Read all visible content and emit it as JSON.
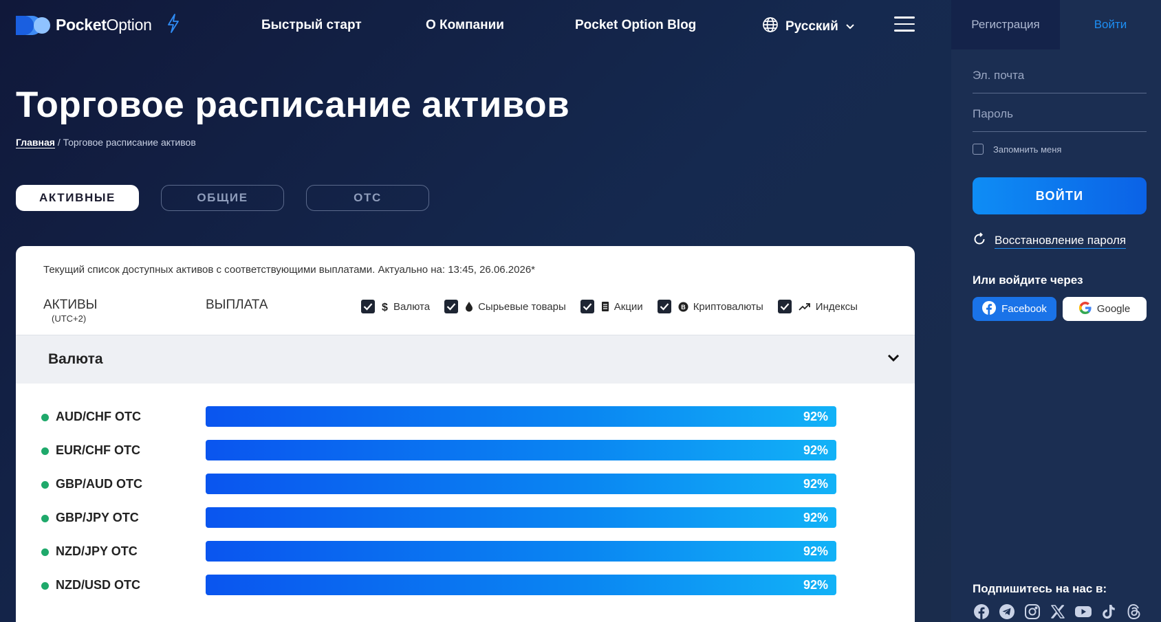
{
  "brand": {
    "name_bold": "Pocket",
    "name_regular": "Option"
  },
  "nav": [
    {
      "label": "Быстрый старт"
    },
    {
      "label": "О Компании"
    },
    {
      "label": "Pocket Option Blog"
    }
  ],
  "language": {
    "label": "Русский"
  },
  "page": {
    "title": "Торговое расписание активов",
    "breadcrumb_home": "Главная",
    "breadcrumb_sep": " / ",
    "breadcrumb_current": "Торговое расписание активов"
  },
  "tabs": [
    {
      "label": "АКТИВНЫЕ",
      "active": true
    },
    {
      "label": "ОБЩИЕ",
      "active": false
    },
    {
      "label": "OTC",
      "active": false
    }
  ],
  "table": {
    "note": "Текущий список доступных активов с соответствующими выплатами. Актуально на: 13:45, 26.06.2026*",
    "col_assets": "АКТИВЫ",
    "col_assets_tz": "(UTC+2)",
    "col_payout": "ВЫПЛАТА",
    "filters": [
      {
        "label": "Валюта",
        "icon": "dollar-icon",
        "checked": true
      },
      {
        "label": "Сырьевые товары",
        "icon": "drop-icon",
        "checked": true
      },
      {
        "label": "Акции",
        "icon": "document-icon",
        "checked": true
      },
      {
        "label": "Криптовалюты",
        "icon": "bitcoin-icon",
        "checked": true
      },
      {
        "label": "Индексы",
        "icon": "trend-up-icon",
        "checked": true
      }
    ],
    "section": "Валюта",
    "rows": [
      {
        "name": "AUD/CHF OTC",
        "payout": "92%",
        "payout_fraction": 1.0
      },
      {
        "name": "EUR/CHF OTC",
        "payout": "92%",
        "payout_fraction": 1.0
      },
      {
        "name": "GBP/AUD OTC",
        "payout": "92%",
        "payout_fraction": 1.0
      },
      {
        "name": "GBP/JPY OTC",
        "payout": "92%",
        "payout_fraction": 1.0
      },
      {
        "name": "NZD/JPY OTC",
        "payout": "92%",
        "payout_fraction": 1.0
      },
      {
        "name": "NZD/USD OTC",
        "payout": "92%",
        "payout_fraction": 1.0
      }
    ]
  },
  "auth": {
    "tab_register": "Регистрация",
    "tab_login": "Войти",
    "email_placeholder": "Эл. почта",
    "password_placeholder": "Пароль",
    "remember": "Запомнить меня",
    "login_button": "ВОЙТИ",
    "recover": "Восстановление пароля",
    "or_login_with": "Или войдите через",
    "facebook": "Facebook",
    "google": "Google",
    "follow": "Подпишитесь на нас в:"
  },
  "colors": {
    "accent_blue": "#1d8ff5",
    "online_dot": "#1fa96b",
    "panel_bg": "#1b2e52"
  }
}
